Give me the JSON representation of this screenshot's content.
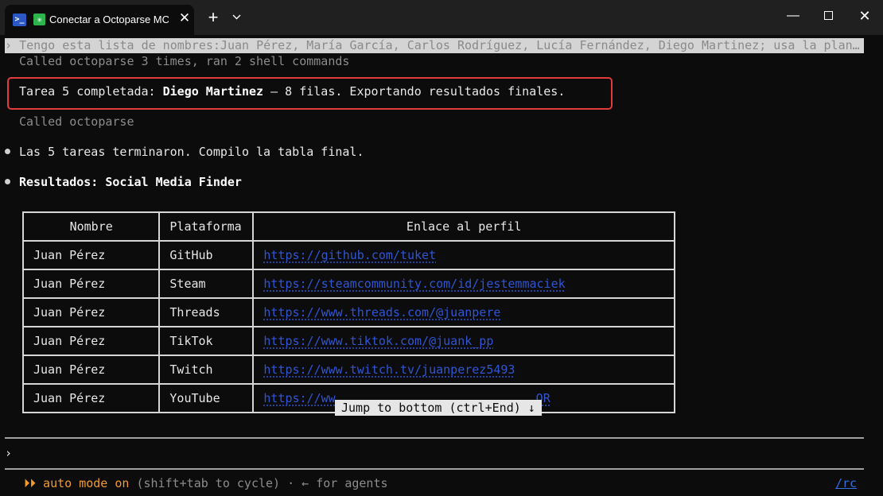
{
  "tab": {
    "title": "Conectar a Octoparse MCP",
    "close": "✕",
    "new_tab": "+",
    "dropdown": "⌄"
  },
  "window": {
    "minimize": "—",
    "close": "✕"
  },
  "terminal": {
    "prompt_marker": "›",
    "user_prompt": "Tengo esta lista de nombres:Juan Pérez, María García, Carlos Rodríguez, Lucía Fernández, Diego Martinez; usa la plan…",
    "called_summary": "Called octoparse 3 times, ran 2 shell commands",
    "task_done_prefix": "Tarea 5 completada: ",
    "task_done_name": "Diego Martinez",
    "task_done_suffix": " — 8 filas. Exportando resultados finales.",
    "called_single": "Called octoparse",
    "tasks_finished": "Las 5 tareas terminaron. Compilo la tabla final.",
    "results_title": "Resultados: Social Media Finder"
  },
  "table": {
    "headers": [
      "Nombre",
      "Plataforma",
      "Enlace al perfil"
    ],
    "rows": [
      {
        "name": "Juan Pérez",
        "platform": "GitHub",
        "link": "https://github.com/tuket"
      },
      {
        "name": "Juan Pérez",
        "platform": "Steam",
        "link": "https://steamcommunity.com/id/jestemmaciek"
      },
      {
        "name": "Juan Pérez",
        "platform": "Threads",
        "link": "https://www.threads.com/@juanpere"
      },
      {
        "name": "Juan Pérez",
        "platform": "TikTok",
        "link": "https://www.tiktok.com/@juank_pp"
      },
      {
        "name": "Juan Pérez",
        "platform": "Twitch",
        "link": "https://www.twitch.tv/juanperez5493"
      },
      {
        "name": "Juan Pérez",
        "platform": "YouTube",
        "link_visible_start": "https://ww",
        "link_visible_end": "OR"
      }
    ]
  },
  "jump_to_bottom": "Jump to bottom (ctrl+End) ↓",
  "input": {
    "prompt_marker": "›"
  },
  "status": {
    "mode_icon": "⏵⏵",
    "mode_label": "auto mode on",
    "hint": " (shift+tab to cycle) · ← for agents",
    "rc": "/rc"
  }
}
